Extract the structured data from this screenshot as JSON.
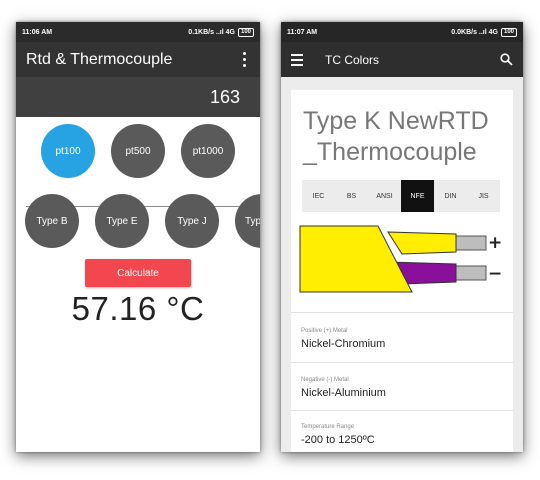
{
  "left_screen": {
    "status": {
      "time": "11:06 AM",
      "network": "0.1KB/s ..ıl 4G",
      "battery": "100"
    },
    "app_title": "Rtd & Thermocouple",
    "display_value": "163",
    "rtd_buttons": [
      {
        "label": "pt100",
        "selected": true
      },
      {
        "label": "pt500",
        "selected": false
      },
      {
        "label": "pt1000",
        "selected": false
      }
    ],
    "tc_buttons": [
      {
        "label": "Type B"
      },
      {
        "label": "Type E"
      },
      {
        "label": "Type J"
      },
      {
        "label": "Typ"
      }
    ],
    "calculate_label": "Calculate",
    "result": "57.16 °C",
    "colors": {
      "accent_blue": "#27a3e3",
      "button_red": "#f2474f",
      "circle_gray": "#5a5a5a"
    }
  },
  "right_screen": {
    "status": {
      "time": "11:07 AM",
      "network": "0.0KB/s ..ıl 4G",
      "battery": "100"
    },
    "toolbar_title": "TC Colors",
    "card_title": "Type K NewRTD _Thermocouple",
    "standards": [
      {
        "label": "IEC",
        "selected": false
      },
      {
        "label": "BS",
        "selected": false
      },
      {
        "label": "ANSI",
        "selected": false
      },
      {
        "label": "NFE",
        "selected": true
      },
      {
        "label": "DIN",
        "selected": false
      },
      {
        "label": "JIS",
        "selected": false
      }
    ],
    "wire": {
      "positive_sign": "+",
      "negative_sign": "−",
      "jacket_color": "#ffee00",
      "positive_color": "#ffee00",
      "negative_color": "#8a0f9a"
    },
    "properties": [
      {
        "label": "Positive (+) Metal",
        "value": "Nickel-Chromium"
      },
      {
        "label": "Negative (-) Metal",
        "value": "Nickel-Aluminium"
      },
      {
        "label": "Temperature Range",
        "value": "-200 to 1250ºC"
      }
    ]
  }
}
